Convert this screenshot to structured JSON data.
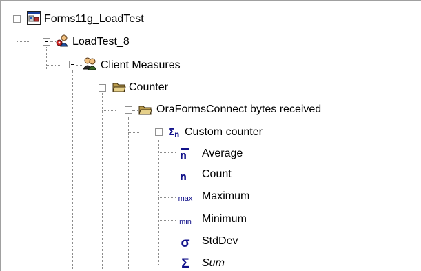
{
  "tree": {
    "root": {
      "label": "Forms11g_LoadTest",
      "icon": "project-icon",
      "expanded": true
    },
    "loadtest": {
      "label": "LoadTest_8",
      "icon": "loadtest-icon",
      "expanded": true
    },
    "client_measures": {
      "label": "Client Measures",
      "icon": "users-icon",
      "expanded": true
    },
    "counter": {
      "label": "Counter",
      "icon": "folder-open-icon",
      "expanded": true
    },
    "oraforms": {
      "label": "OraFormsConnect bytes received",
      "icon": "folder-open-icon",
      "expanded": true
    },
    "custom_counter": {
      "label": "Custom counter",
      "icon": "sigma-n-icon",
      "expanded": true
    },
    "stats": [
      {
        "label": "Average",
        "icon": "average-icon",
        "italic": false
      },
      {
        "label": "Count",
        "icon": "count-icon",
        "italic": false
      },
      {
        "label": "Maximum",
        "icon": "max-icon",
        "glyph": "max",
        "italic": false
      },
      {
        "label": "Minimum",
        "icon": "min-icon",
        "glyph": "min",
        "italic": false
      },
      {
        "label": "StdDev",
        "icon": "sigma-lower-icon",
        "glyph": "σ",
        "italic": false
      },
      {
        "label": "Sum",
        "icon": "sum-icon",
        "glyph": "Σ",
        "italic": true
      }
    ]
  },
  "colors": {
    "stat_glyph": "#12128a",
    "tree_lines": "#8c8c8c",
    "folder": "#d8c27a"
  }
}
